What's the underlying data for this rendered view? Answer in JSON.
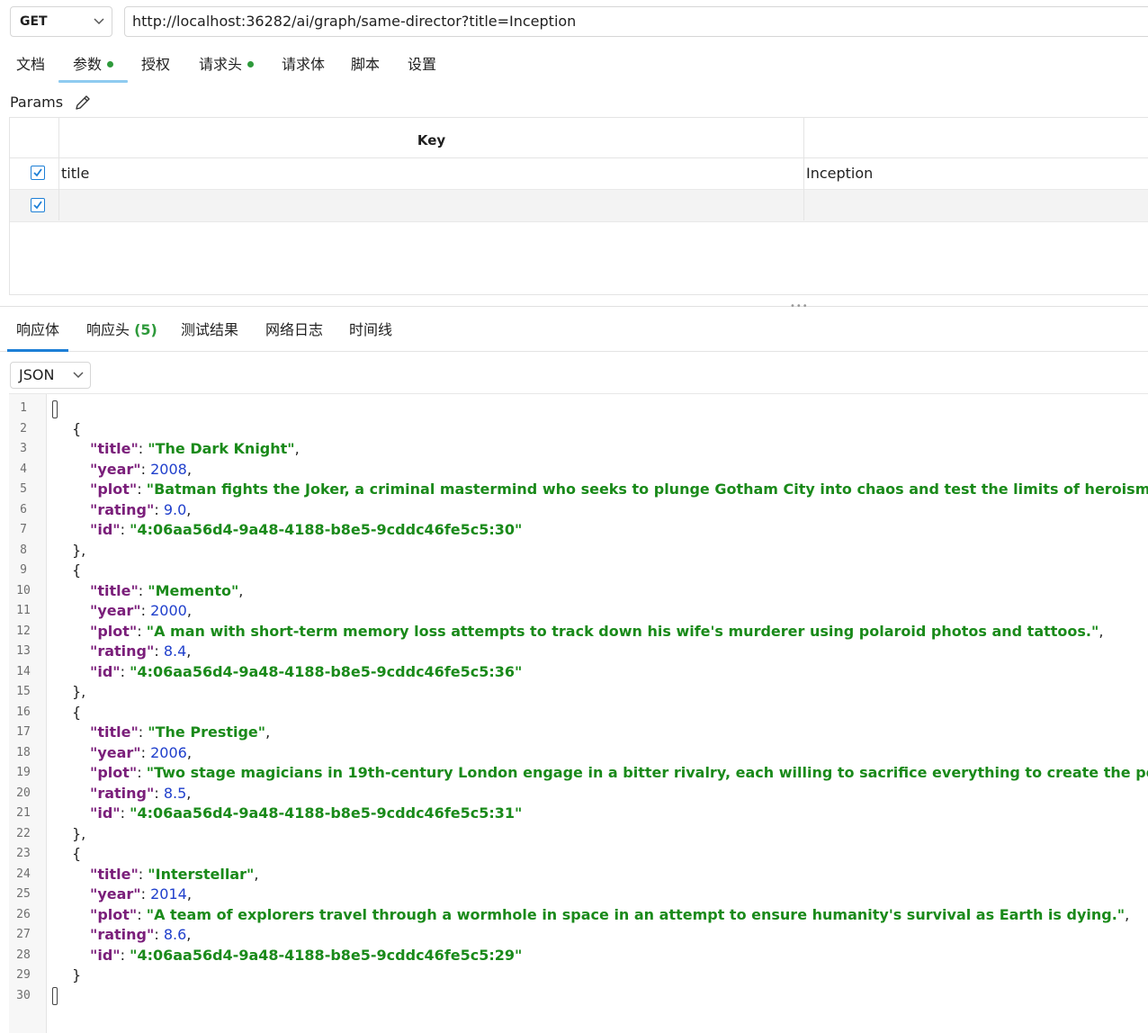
{
  "request": {
    "method": "GET",
    "url": "http://localhost:36282/ai/graph/same-director?title=Inception"
  },
  "request_tabs": [
    {
      "label": "文档"
    },
    {
      "label": "参数",
      "active": true,
      "has_dot": true
    },
    {
      "label": "授权"
    },
    {
      "label": "请求头",
      "has_dot": true
    },
    {
      "label": "请求体"
    },
    {
      "label": "脚本"
    },
    {
      "label": "设置"
    }
  ],
  "params": {
    "title": "Params",
    "key_header": "Key",
    "rows": [
      {
        "checked": true,
        "key": "title",
        "value": "Inception"
      },
      {
        "checked": true,
        "key": "",
        "value": ""
      }
    ]
  },
  "response_tabs": [
    {
      "label": "响应体",
      "active": true
    },
    {
      "label": "响应头",
      "count": "(5)"
    },
    {
      "label": "测试结果"
    },
    {
      "label": "网络日志"
    },
    {
      "label": "时间线"
    }
  ],
  "response": {
    "format": "JSON",
    "movies": [
      {
        "title": "The Dark Knight",
        "year": "2008",
        "plot": "Batman fights the Joker, a criminal mastermind who seeks to plunge Gotham City into chaos and test the limits of heroism.",
        "rating": "9.0",
        "id": "4:06aa56d4-9a48-4188-b8e5-9cddc46fe5c5:30"
      },
      {
        "title": "Memento",
        "year": "2000",
        "plot": "A man with short-term memory loss attempts to track down his wife's murderer using polaroid photos and tattoos.",
        "rating": "8.4",
        "id": "4:06aa56d4-9a48-4188-b8e5-9cddc46fe5c5:36"
      },
      {
        "title": "The Prestige",
        "year": "2006",
        "plot": "Two stage magicians in 19th-century London engage in a bitter rivalry, each willing to sacrifice everything to create the perfect illusion.",
        "rating": "8.5",
        "id": "4:06aa56d4-9a48-4188-b8e5-9cddc46fe5c5:31"
      },
      {
        "title": "Interstellar",
        "year": "2014",
        "plot": "A team of explorers travel through a wormhole in space in an attempt to ensure humanity's survival as Earth is dying.",
        "rating": "8.6",
        "id": "4:06aa56d4-9a48-4188-b8e5-9cddc46fe5c5:29"
      }
    ],
    "line_numbers": [
      "1",
      "2",
      "3",
      "4",
      "5",
      "6",
      "7",
      "8",
      "9",
      "10",
      "11",
      "12",
      "13",
      "14",
      "15",
      "16",
      "17",
      "18",
      "19",
      "20",
      "21",
      "22",
      "23",
      "24",
      "25",
      "26",
      "27",
      "28",
      "29",
      "30"
    ]
  },
  "colors": {
    "accent": "#1d7fd6",
    "dot": "#2e9a3b",
    "json_key": "#7a1e7a",
    "json_string": "#1a8a1a",
    "json_number": "#1f3fcc"
  }
}
